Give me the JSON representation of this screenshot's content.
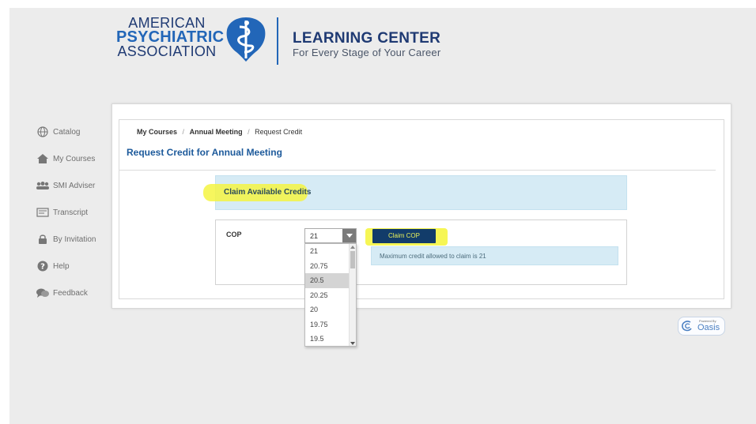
{
  "header": {
    "org_line1": "AMERICAN",
    "org_line2": "PSYCHIATRIC",
    "org_line3": "ASSOCIATION",
    "title": "LEARNING CENTER",
    "subtitle": "For Every Stage of Your Career"
  },
  "sidebar": {
    "items": [
      {
        "label": "Catalog",
        "icon": "globe-icon"
      },
      {
        "label": "My Courses",
        "icon": "house-icon"
      },
      {
        "label": "SMI Adviser",
        "icon": "group-icon"
      },
      {
        "label": "Transcript",
        "icon": "transcript-icon"
      },
      {
        "label": "By Invitation",
        "icon": "lock-icon"
      },
      {
        "label": "Help",
        "icon": "question-icon"
      },
      {
        "label": "Feedback",
        "icon": "chat-icon"
      }
    ]
  },
  "breadcrumb": {
    "items": [
      "My Courses",
      "Annual Meeting",
      "Request Credit"
    ],
    "separator": "/"
  },
  "page_title": "Request Credit for Annual Meeting",
  "claim_banner": "Claim Available Credits",
  "credit_form": {
    "label": "COP",
    "selected_value": "21",
    "options": [
      "21",
      "20.75",
      "20.5",
      "20.25",
      "20",
      "19.75",
      "19.5"
    ],
    "highlighted_option": "20.5",
    "button_label": "Claim COP",
    "max_info": "Maximum credit allowed to claim is 21"
  },
  "footer": {
    "powered_by": "Powered By",
    "brand": "Oasis"
  },
  "colors": {
    "brand_blue": "#1d5a9b",
    "button_bg": "#123c6a",
    "highlight": "#f5f542",
    "info_bg": "#d6ebf5"
  }
}
